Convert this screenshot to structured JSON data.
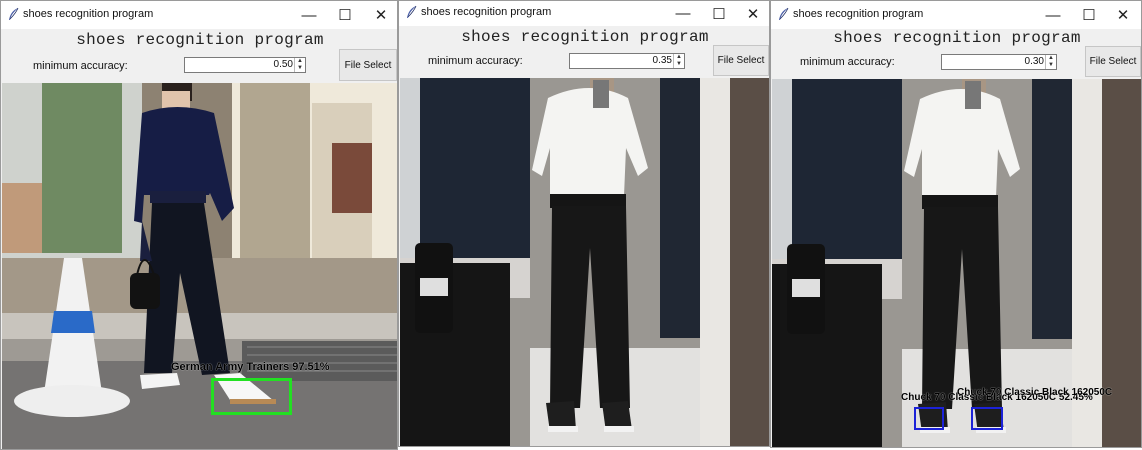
{
  "colors": {
    "detection_green": "#22e022",
    "detection_blue": "#1c22d8"
  },
  "windows": [
    {
      "title": "shoes recognition program",
      "app_title": "shoes recognition program",
      "accuracy_label": "minimum accuracy:",
      "accuracy_value": "0.50",
      "file_button": "File Select",
      "detections": [
        {
          "label": "German Army Trainers 97.51%",
          "color": "green"
        }
      ]
    },
    {
      "title": "shoes recognition program",
      "app_title": "shoes recognition program",
      "accuracy_label": "minimum accuracy:",
      "accuracy_value": "0.35",
      "file_button": "File Select",
      "detections": []
    },
    {
      "title": "shoes recognition program",
      "app_title": "shoes recognition program",
      "accuracy_label": "minimum accuracy:",
      "accuracy_value": "0.30",
      "file_button": "File Select",
      "detections": [
        {
          "label": "Chuck 70 Classic Black 162050C 52.45%",
          "color": "blue"
        },
        {
          "label": "Chuck 70 Classic Black 162050C",
          "color": "blue"
        }
      ]
    }
  ],
  "window_controls": {
    "minimize": "—",
    "maximize": "☐",
    "close": "✕"
  }
}
